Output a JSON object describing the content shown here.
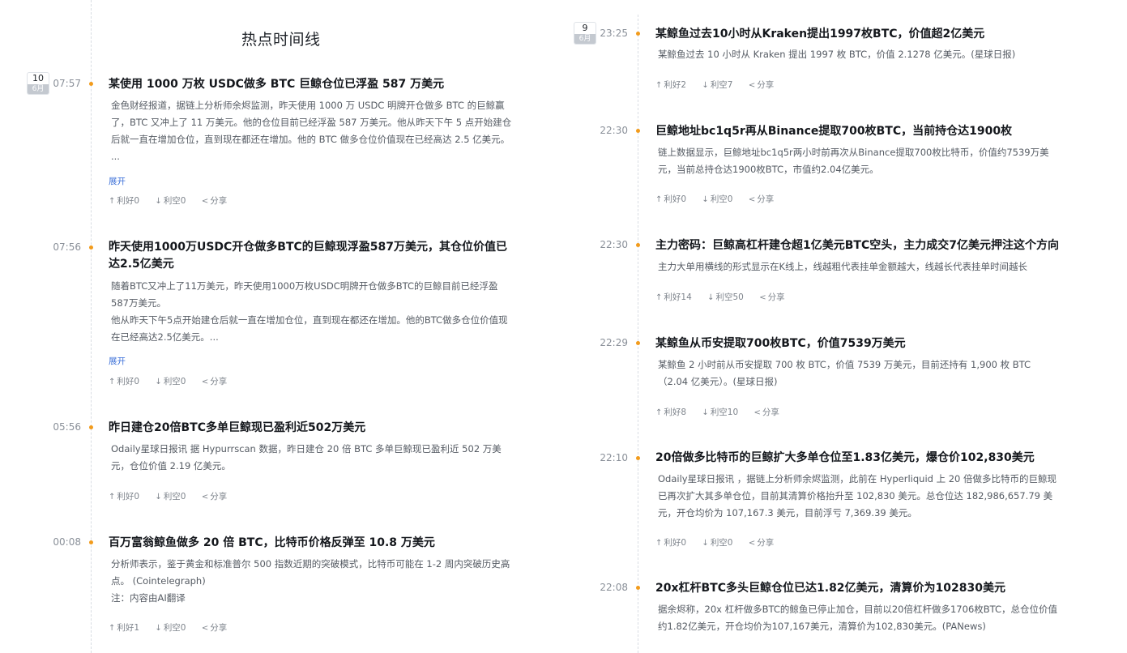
{
  "page_title": "热点时间线",
  "left_date": {
    "day": "10",
    "month": "6月"
  },
  "right_date": {
    "day": "9",
    "month": "6月"
  },
  "labels": {
    "expand": "展开",
    "bull": "利好",
    "bear": "利空",
    "share": "分享"
  },
  "icons": {
    "bull": "arrow-up-icon",
    "bear": "arrow-down-icon",
    "share": "share-icon"
  },
  "left_items": [
    {
      "time": "07:57",
      "title": "某使用 1000 万枚 USDC做多 BTC 巨鲸仓位已浮盈 587 万美元",
      "content": "金色财经报道，据链上分析师余烬监测，昨天使用 1000 万 USDC 明牌开仓做多 BTC 的巨鲸赢了，BTC 又冲上了 11 万美元。他的仓位目前已经浮盈 587 万美元。他从昨天下午 5 点开始建仓后就一直在增加仓位，直到现在都还在增加。他的 BTC 做多仓位价值现在已经高达 2.5 亿美元。 ...",
      "expand": true,
      "bull": "利好0",
      "bear": "利空0",
      "share": "分享"
    },
    {
      "time": "07:56",
      "title": "昨天使用1000万USDC开仓做多BTC的巨鲸现浮盈587万美元，其仓位价值已达2.5亿美元",
      "content": "随着BTC又冲上了11万美元，昨天使用1000万枚USDC明牌开仓做多BTC的巨鲸目前已经浮盈587万美元。\n他从昨天下午5点开始建仓后就一直在增加仓位，直到现在都还在增加。他的BTC做多仓位价值现在已经高达2.5亿美元。...",
      "expand": true,
      "bull": "利好0",
      "bear": "利空0",
      "share": "分享"
    },
    {
      "time": "05:56",
      "title": "昨日建仓20倍BTC多单巨鲸现已盈利近502万美元",
      "content": "Odaily星球日报讯 据 Hypurrscan 数据，昨日建仓 20 倍 BTC 多单巨鲸现已盈利近 502 万美元，仓位价值 2.19 亿美元。",
      "expand": false,
      "bull": "利好0",
      "bear": "利空0",
      "share": "分享"
    },
    {
      "time": "00:08",
      "title": "百万富翁鲸鱼做多 20 倍 BTC，比特币价格反弹至 10.8 万美元",
      "content": "分析师表示，鉴于黄金和标准普尔 500 指数近期的突破模式，比特币可能在 1-2 周内突破历史高点。 (Cointelegraph)\n注：内容由AI翻译",
      "expand": false,
      "bull": "利好1",
      "bear": "利空0",
      "share": "分享"
    }
  ],
  "right_items": [
    {
      "time": "23:25",
      "title": "某鲸鱼过去10小时从Kraken提出1997枚BTC，价值超2亿美元",
      "content": "某鲸鱼过去 10 小时从 Kraken 提出 1997 枚 BTC，价值 2.1278 亿美元。(星球日报)",
      "bull": "利好2",
      "bear": "利空7",
      "share": "分享"
    },
    {
      "time": "22:30",
      "title": "巨鲸地址bc1q5r再从Binance提取700枚BTC，当前持仓达1900枚",
      "content": "链上数据显示，巨鲸地址bc1q5r两小时前再次从Binance提取700枚比特币，价值约7539万美元，当前总持仓达1900枚BTC，市值约2.04亿美元。",
      "bull": "利好0",
      "bear": "利空0",
      "share": "分享"
    },
    {
      "time": "22:30",
      "title": "主力密码：巨鲸高杠杆建仓超1亿美元BTC空头，主力成交7亿美元押注这个方向",
      "content": "主力大单用横线的形式显示在K线上，线越粗代表挂单金额越大，线越长代表挂单时间越长",
      "bull": "利好14",
      "bear": "利空50",
      "share": "分享"
    },
    {
      "time": "22:29",
      "title": "某鲸鱼从币安提取700枚BTC，价值7539万美元",
      "content": "某鲸鱼 2 小时前从币安提取 700 枚 BTC，价值 7539 万美元，目前还持有 1,900 枚 BTC （2.04 亿美元）。(星球日报)",
      "bull": "利好8",
      "bear": "利空10",
      "share": "分享"
    },
    {
      "time": "22:10",
      "title": "20倍做多比特币的巨鲸扩大多单仓位至1.83亿美元，爆仓价102,830美元",
      "content": "Odaily星球日报讯 ，据链上分析师余烬监测，此前在 Hyperliquid 上 20 倍做多比特币的巨鲸现已再次扩大其多单仓位，目前其清算价格抬升至 102,830 美元。总仓位达 182,986,657.79 美元，开仓均价为 107,167.3 美元，目前浮亏 7,369.39 美元。",
      "bull": "利好0",
      "bear": "利空0",
      "share": "分享"
    },
    {
      "time": "22:08",
      "title": "20x杠杆BTC多头巨鲸仓位已达1.82亿美元，清算价为102830美元",
      "content": "据余烬称，20x 杠杆做多BTC的鲸鱼已停止加仓，目前以20倍杠杆做多1706枚BTC，总仓位价值约1.82亿美元，开仓均价为107,167美元，清算价为102,830美元。(PANews)",
      "bull": "",
      "bear": "",
      "share": ""
    }
  ]
}
